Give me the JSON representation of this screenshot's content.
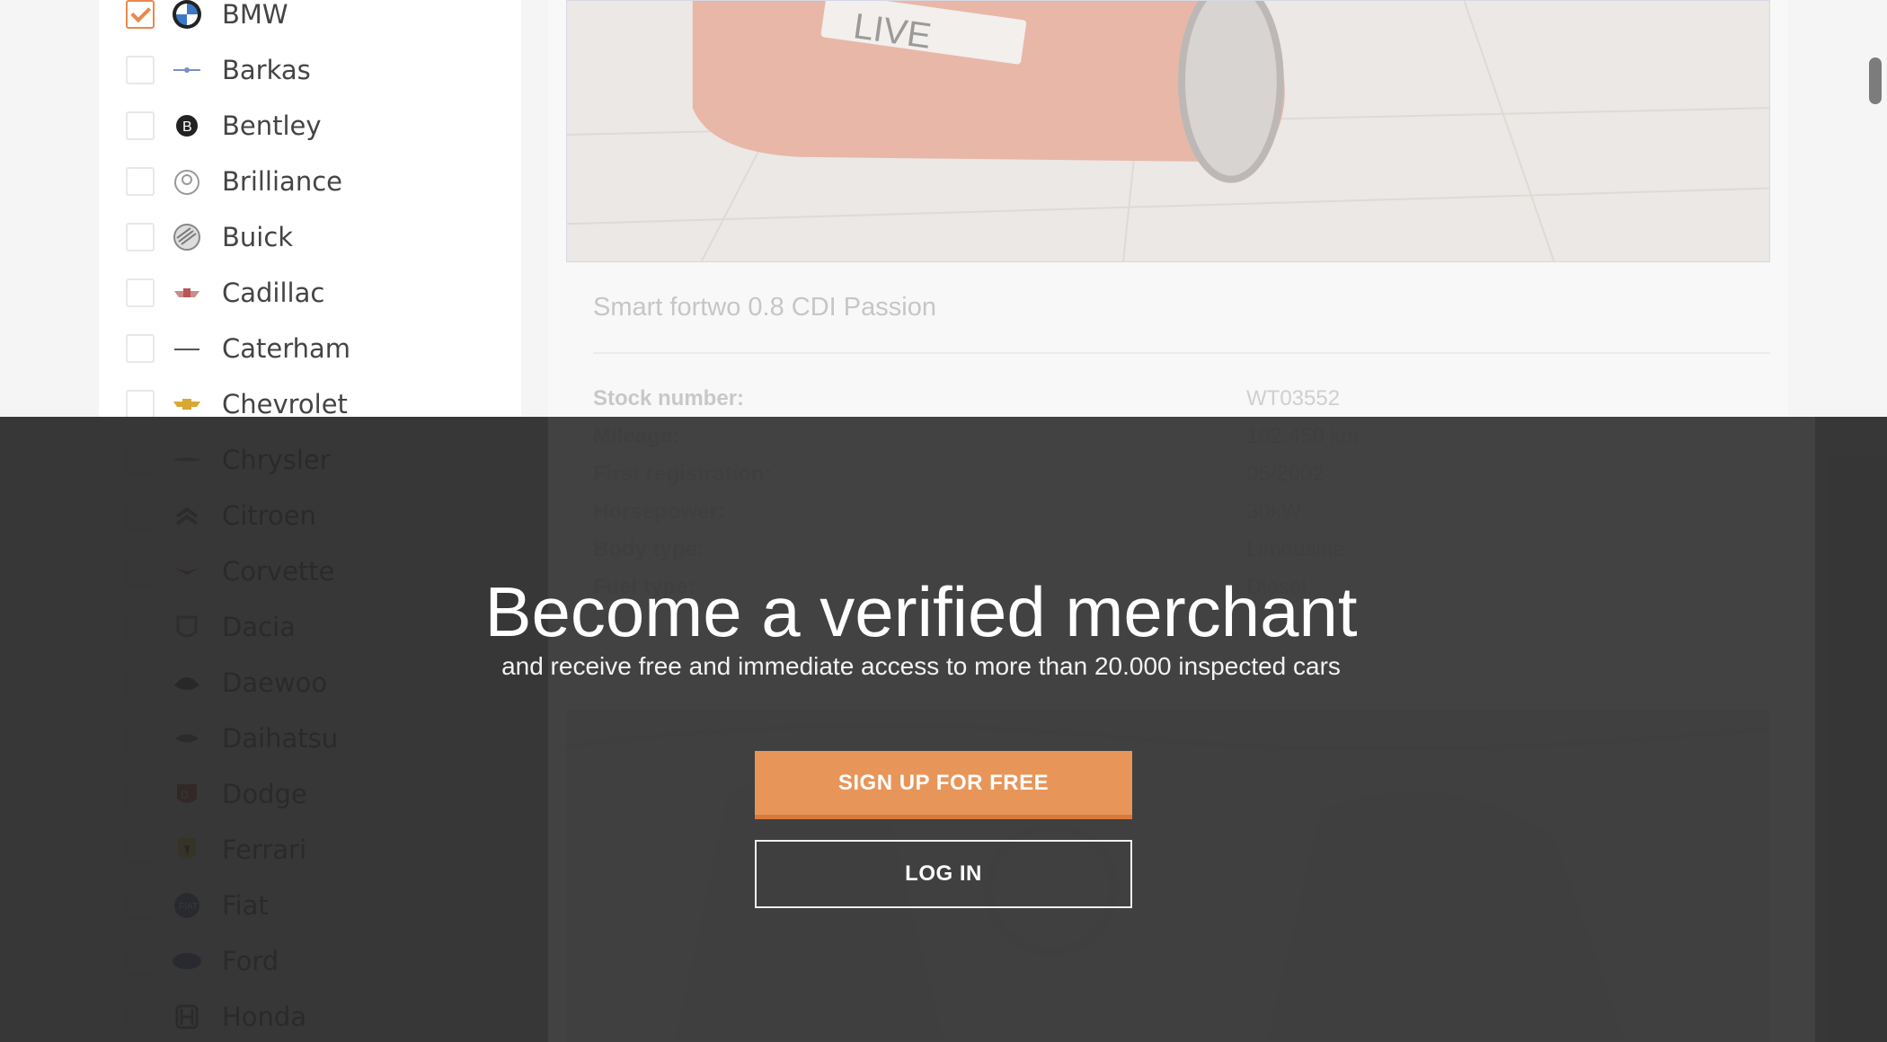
{
  "sidebar": {
    "brands": [
      {
        "name": "BMW",
        "checked": true,
        "logo": "bmw-logo"
      },
      {
        "name": "Barkas",
        "checked": false,
        "logo": "barkas-logo"
      },
      {
        "name": "Bentley",
        "checked": false,
        "logo": "bentley-logo"
      },
      {
        "name": "Brilliance",
        "checked": false,
        "logo": "brilliance-logo"
      },
      {
        "name": "Buick",
        "checked": false,
        "logo": "buick-logo"
      },
      {
        "name": "Cadillac",
        "checked": false,
        "logo": "cadillac-logo"
      },
      {
        "name": "Caterham",
        "checked": false,
        "logo": "caterham-logo"
      },
      {
        "name": "Chevrolet",
        "checked": false,
        "logo": "chevrolet-logo"
      },
      {
        "name": "Chrysler",
        "checked": false,
        "logo": "chrysler-logo"
      },
      {
        "name": "Citroen",
        "checked": false,
        "logo": "citroen-logo"
      },
      {
        "name": "Corvette",
        "checked": false,
        "logo": "corvette-logo"
      },
      {
        "name": "Dacia",
        "checked": false,
        "logo": "dacia-logo"
      },
      {
        "name": "Daewoo",
        "checked": false,
        "logo": "daewoo-logo"
      },
      {
        "name": "Daihatsu",
        "checked": false,
        "logo": "daihatsu-logo"
      },
      {
        "name": "Dodge",
        "checked": false,
        "logo": "dodge-logo"
      },
      {
        "name": "Ferrari",
        "checked": false,
        "logo": "ferrari-logo"
      },
      {
        "name": "Fiat",
        "checked": false,
        "logo": "fiat-logo"
      },
      {
        "name": "Ford",
        "checked": false,
        "logo": "ford-logo"
      },
      {
        "name": "Honda",
        "checked": false,
        "logo": "honda-logo"
      }
    ]
  },
  "listing": {
    "plate_text": "LIVE",
    "title": "Smart fortwo 0.8 CDI Passion",
    "specs": [
      {
        "label": "Stock number:",
        "value": "WT03552"
      },
      {
        "label": "Mileage:",
        "value": "192.450 km"
      },
      {
        "label": "First registration:",
        "value": "05/2002"
      },
      {
        "label": "Horsepower:",
        "value": "30kW"
      },
      {
        "label": "Body type:",
        "value": "Limousine"
      },
      {
        "label": "Fuel type:",
        "value": "Diesel"
      }
    ]
  },
  "modal": {
    "title": "Become a verified merchant",
    "subtitle": "and receive free and immediate access to more than 20.000 inspected cars",
    "signup_label": "SIGN UP FOR FREE",
    "login_label": "LOG IN"
  },
  "colors": {
    "accent": "#e8955a",
    "checkbox_checked": "#e8894d",
    "overlay": "#282828"
  }
}
